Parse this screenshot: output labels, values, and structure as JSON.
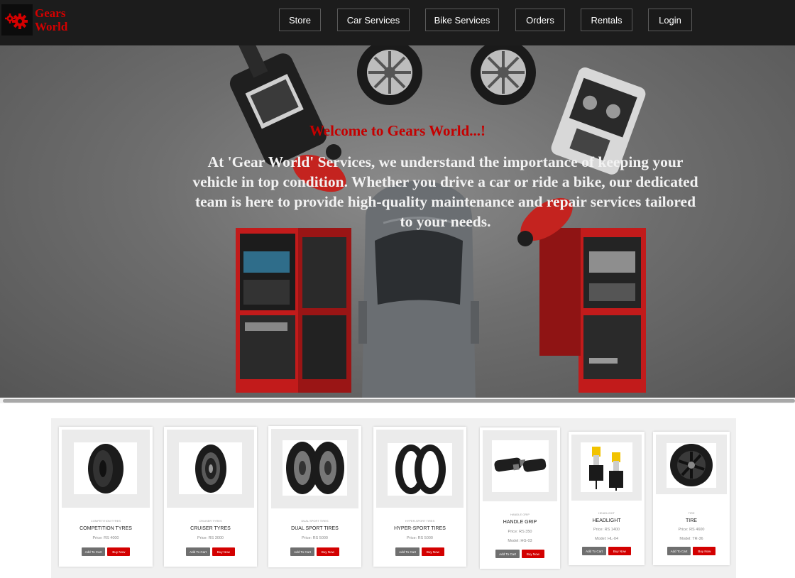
{
  "brand": {
    "line1": "Gears",
    "line2": "World"
  },
  "nav": [
    {
      "label": "Store"
    },
    {
      "label": "Car Services"
    },
    {
      "label": "Bike Services"
    },
    {
      "label": "Orders"
    },
    {
      "label": "Rentals"
    },
    {
      "label": "Login"
    }
  ],
  "hero": {
    "title": "Welcome to Gears World...!",
    "description": "At 'Gear World' Services, we understand the importance of keeping your vehicle in top condition. Whether you drive a car or ride a bike, our dedicated team is here to provide high-quality maintenance and repair services tailored to your needs."
  },
  "products": [
    {
      "category": "COMPETITION TYRES",
      "name": "COMPETITION TYRES",
      "price": "Price: RS 4000",
      "cart": "Add To Cart",
      "buy": "Buy Now"
    },
    {
      "category": "CRUISER TYRES",
      "name": "CRUISER TYRES",
      "price": "Price: RS 3000",
      "cart": "Add To Cart",
      "buy": "Buy Now"
    },
    {
      "category": "DUAL SPORT TIRES",
      "name": "DUAL SPORT TIRES",
      "price": "Price: RS 5000",
      "cart": "Add To Cart",
      "buy": "Buy Now"
    },
    {
      "category": "HYPER-SPORT TIRES",
      "name": "HYPER-SPORT TIRES",
      "price": "Price: RS 5000",
      "cart": "Add To Cart",
      "buy": "Buy Now"
    },
    {
      "category": "HANDLE GRIP",
      "name": "HANDLE GRIP",
      "price": "Price: RS 350",
      "model": "Model: HG-03",
      "cart": "Add To Cart",
      "buy": "Buy Now"
    },
    {
      "category": "HEADLIGHT",
      "name": "HEADLIGHT",
      "price": "Price: RS 1400",
      "model": "Model: HL-04",
      "cart": "Add To Cart",
      "buy": "Buy Now"
    },
    {
      "category": "TIRE",
      "name": "TIRE",
      "price": "Price: RS 4600",
      "model": "Model: TR-36",
      "cart": "Add To Cart",
      "buy": "Buy Now"
    }
  ]
}
